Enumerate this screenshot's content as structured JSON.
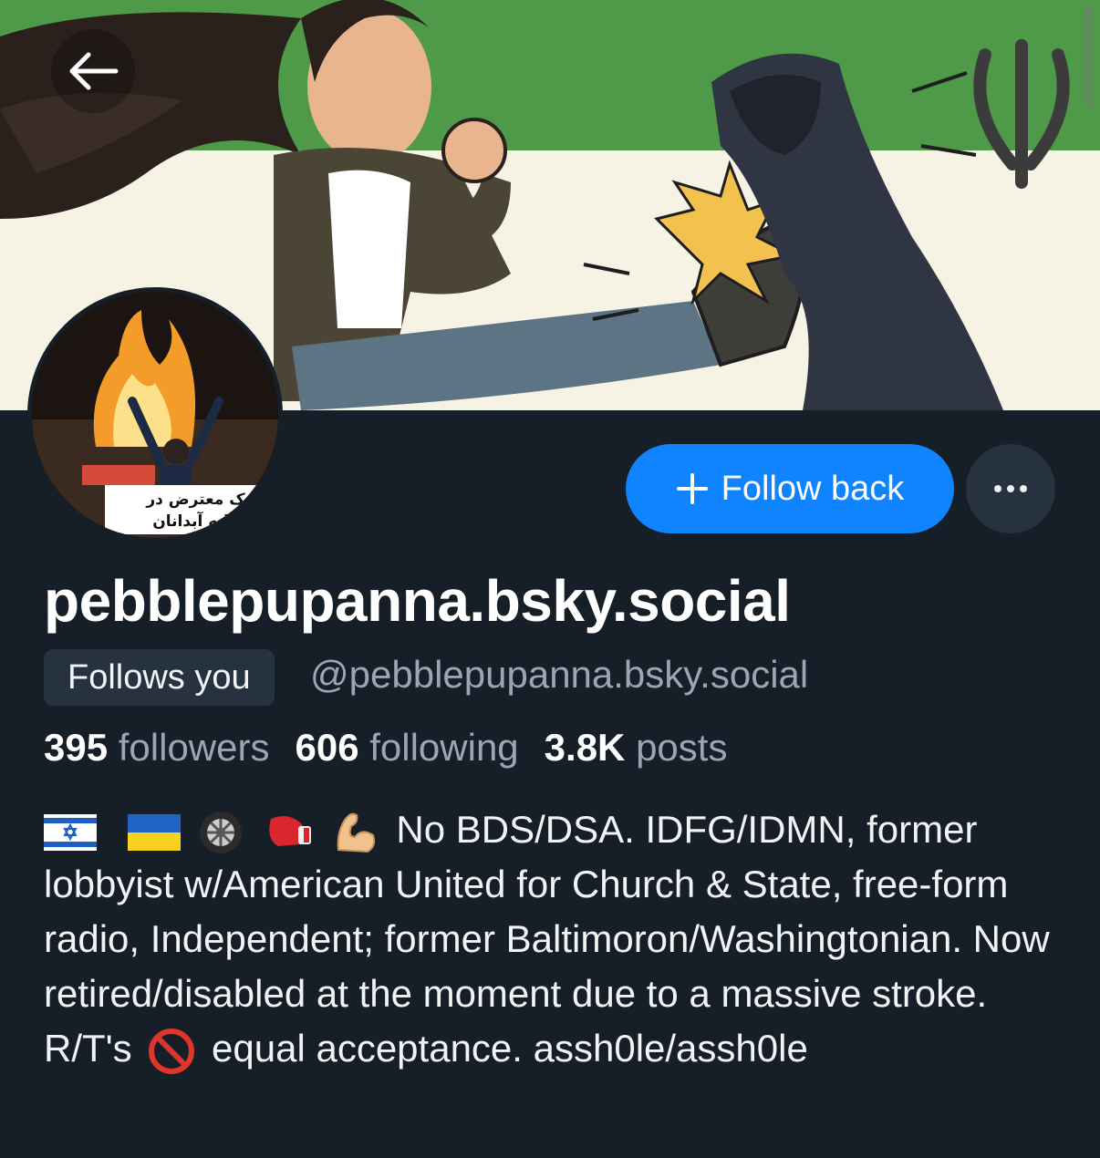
{
  "banner": {
    "description_icon": "cartoon-banner-image",
    "colors": {
      "green": "#4e9a48",
      "cream": "#f6f2e4"
    }
  },
  "nav": {
    "back_icon": "arrow-left-icon"
  },
  "avatar": {
    "caption_line1": "یک معترض در",
    "caption_line2": "شبانه آبدانان"
  },
  "actions": {
    "follow_label": "Follow back",
    "follow_icon": "plus-icon",
    "more_icon": "ellipsis-icon"
  },
  "profile": {
    "display_name": "pebblepupanna.bsky.social",
    "follows_you": "Follows you",
    "handle": "@pebblepupanna.bsky.social"
  },
  "stats": {
    "followers_count": "395",
    "followers_label": "followers",
    "following_count": "606",
    "following_label": "following",
    "posts_count": "3.8K",
    "posts_label": "posts"
  },
  "bio": {
    "emoji_icons": [
      "israel-flag-icon",
      "ukraine-flag-icon",
      "wheel-icon",
      "boxing-glove-icon",
      "flexed-biceps-icon"
    ],
    "text_part1": "No BDS/DSA. IDFG/IDMN, former lobbyist w/American United for Church & State, free-form radio, Independent; former Baltimoron/Washingtonian. Now retired/disabled at the moment due to a massive stroke. R/T's",
    "prohibited_icon": "prohibited-icon",
    "text_part2": "equal acceptance. assh0le/assh0le"
  },
  "theme": {
    "background": "#161e27",
    "accent": "#1083fe",
    "muted_text": "#9aa6b6",
    "chip_bg": "#273241"
  }
}
